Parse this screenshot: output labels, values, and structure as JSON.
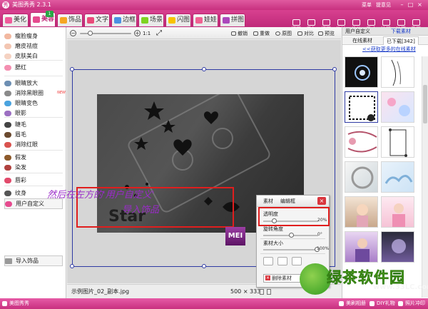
{
  "window": {
    "title": "美图秀秀 2.3.1",
    "menu": "菜单",
    "feedback": "提意见"
  },
  "tabs": [
    {
      "label": "美化",
      "color": "#f05a9a"
    },
    {
      "label": "美容",
      "color": "#e64b8f",
      "badge": "1"
    },
    {
      "label": "饰品",
      "color": "#f5a623"
    },
    {
      "label": "文字",
      "color": "#e94b7a"
    },
    {
      "label": "边框",
      "color": "#4a90e2"
    },
    {
      "label": "场景",
      "color": "#7ed321"
    },
    {
      "label": "闪图",
      "color": "#f8c200"
    },
    {
      "label": "娃娃",
      "color": "#f06292"
    },
    {
      "label": "拼图",
      "color": "#ab47bc"
    }
  ],
  "toolbar": {
    "items": [
      {
        "label": "打开",
        "icon": "folder-icon"
      },
      {
        "label": "保存",
        "icon": "save-icon"
      },
      {
        "label": "抠图",
        "icon": "cutout-icon"
      },
      {
        "label": "旋转",
        "icon": "rotate-icon"
      },
      {
        "label": "裁剪",
        "icon": "crop-icon"
      },
      {
        "label": "尺寸",
        "icon": "resize-icon"
      },
      {
        "label": "涂鸦",
        "icon": "brush-icon"
      },
      {
        "label": "拍照",
        "icon": "camera-icon"
      },
      {
        "label": "看图",
        "icon": "view-icon"
      }
    ]
  },
  "left_panel": {
    "items": [
      {
        "label": "瘦脸瘦身",
        "color": "#f2b8a0"
      },
      {
        "label": "磨皮祛痘",
        "color": "#f3c6b2"
      },
      {
        "label": "皮肤美白",
        "color": "#f5d2c2"
      },
      {
        "label": "腮红",
        "color": "#f48fb1"
      },
      {
        "label": "眼睛放大",
        "color": "#6d8fb3"
      },
      {
        "label": "消除黑眼圈",
        "color": "#8a8a8a",
        "new": "NEW"
      },
      {
        "label": "眼睛变色",
        "color": "#4aa3df"
      },
      {
        "label": "眼影",
        "color": "#9c6fc2"
      },
      {
        "label": "睫毛",
        "color": "#444444"
      },
      {
        "label": "眉毛",
        "color": "#6b4a2f"
      },
      {
        "label": "消除红眼",
        "color": "#d9534f"
      },
      {
        "label": "假发",
        "color": "#8d5a2b"
      },
      {
        "label": "染发",
        "color": "#b0413e"
      },
      {
        "label": "唇彩",
        "color": "#e24a6b"
      },
      {
        "label": "纹身",
        "color": "#555555"
      },
      {
        "label": "用户自定义",
        "color": "#e64b8f"
      }
    ],
    "import_button": "导入饰品"
  },
  "canvas_toolbar": {
    "zoom_ratio": "1:1",
    "zoom_level": 0.2,
    "undo": "撤销",
    "redo": "重做",
    "original": "原图",
    "compare": "对比",
    "preview": "预览"
  },
  "canvas": {
    "annotation_line1": "然后在左方的'用户自定义'",
    "annotation_line2": "导入饰品",
    "logo_text": "MEI",
    "photo_text": "Star"
  },
  "material_dialog": {
    "tab_material": "素材",
    "tab_edit": "编辑框",
    "opacity_label": "透明度",
    "opacity_value": "20%",
    "opacity_level": 0.2,
    "rotate_label": "旋转角度",
    "rotate_value": "0°",
    "rotate_level": 0.5,
    "size_label": "素材大小",
    "size_value": "100%",
    "size_level": 1.0,
    "delete_label": "删除素材"
  },
  "statusbar": {
    "filename": "示例图片_02_副本.jpg",
    "dimensions": "500 × 333"
  },
  "right_panel": {
    "tab_custom": "用户自定义",
    "tab_download": "下载素材",
    "subtab_online": "在线素材",
    "subtab_downloaded": "已下载[342]",
    "link": "<<获取更多的在线素材"
  },
  "bottombar": {
    "items": [
      {
        "label": "美图秀秀",
        "icon": "meitu-icon"
      },
      {
        "label": "美刷相册",
        "icon": "album-icon"
      },
      {
        "label": "DIY礼物",
        "icon": "gift-icon"
      },
      {
        "label": "照片冲印",
        "icon": "print-icon"
      }
    ]
  },
  "watermark": {
    "text": "绿茶软件园",
    "url": "www.33LC.com"
  }
}
